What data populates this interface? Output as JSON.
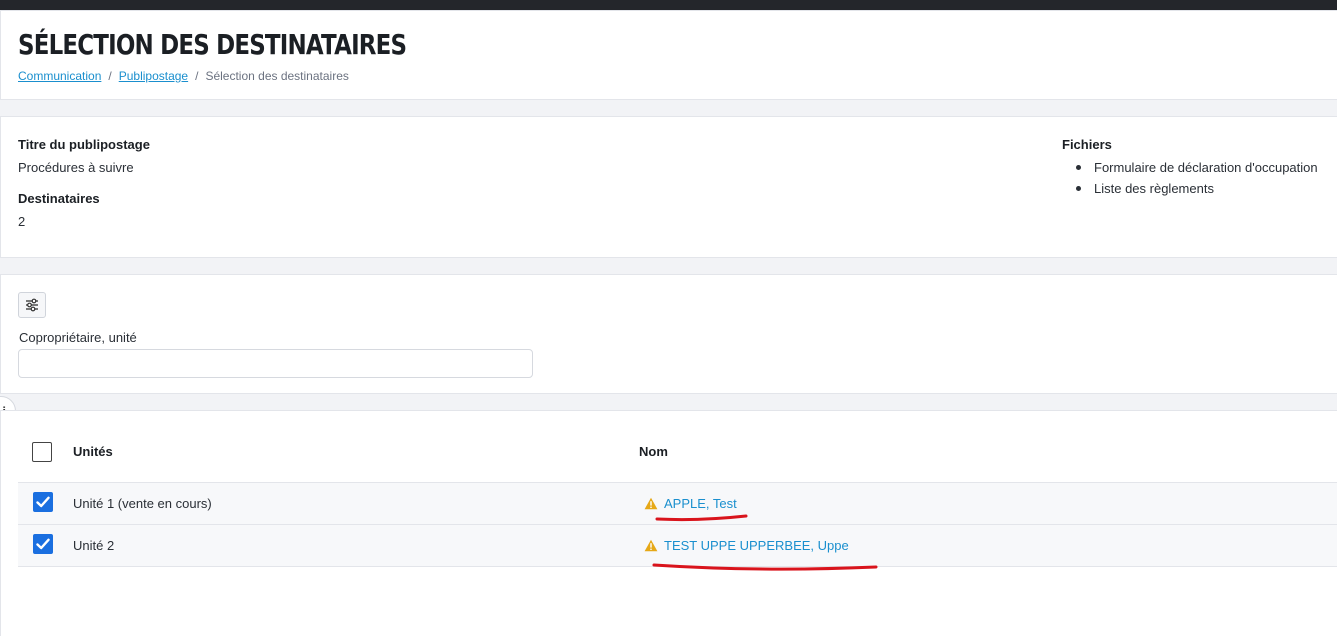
{
  "header": {
    "title": "SÉLECTION DES DESTINATAIRES",
    "breadcrumb": {
      "item1": "Communication",
      "item2": "Publipostage",
      "current": "Sélection des destinataires",
      "separator": "/"
    }
  },
  "info": {
    "title_label": "Titre du publipostage",
    "title_value": "Procédures à suivre",
    "recipients_label": "Destinataires",
    "recipients_value": "2",
    "files_label": "Fichiers",
    "files": [
      "Formulaire de déclaration d'occupation",
      "Liste des règlements"
    ]
  },
  "filter": {
    "field_label": "Copropriétaire, unité",
    "field_value": "",
    "filter_icon": "sliders-icon"
  },
  "side_tab": {
    "label": "i"
  },
  "table": {
    "columns": {
      "units": "Unités",
      "name": "Nom"
    },
    "rows": [
      {
        "unit": "Unité 1 (vente en cours)",
        "name": "APPLE, Test",
        "checked": true,
        "warning": true
      },
      {
        "unit": "Unité 2",
        "name": "TEST UPPE UPPERBEE, Uppe",
        "checked": true,
        "warning": true
      }
    ]
  },
  "colors": {
    "link": "#1a8fce",
    "checkbox_checked": "#1a6fe0",
    "warning": "#e6a817",
    "annotation": "#d9141c"
  }
}
